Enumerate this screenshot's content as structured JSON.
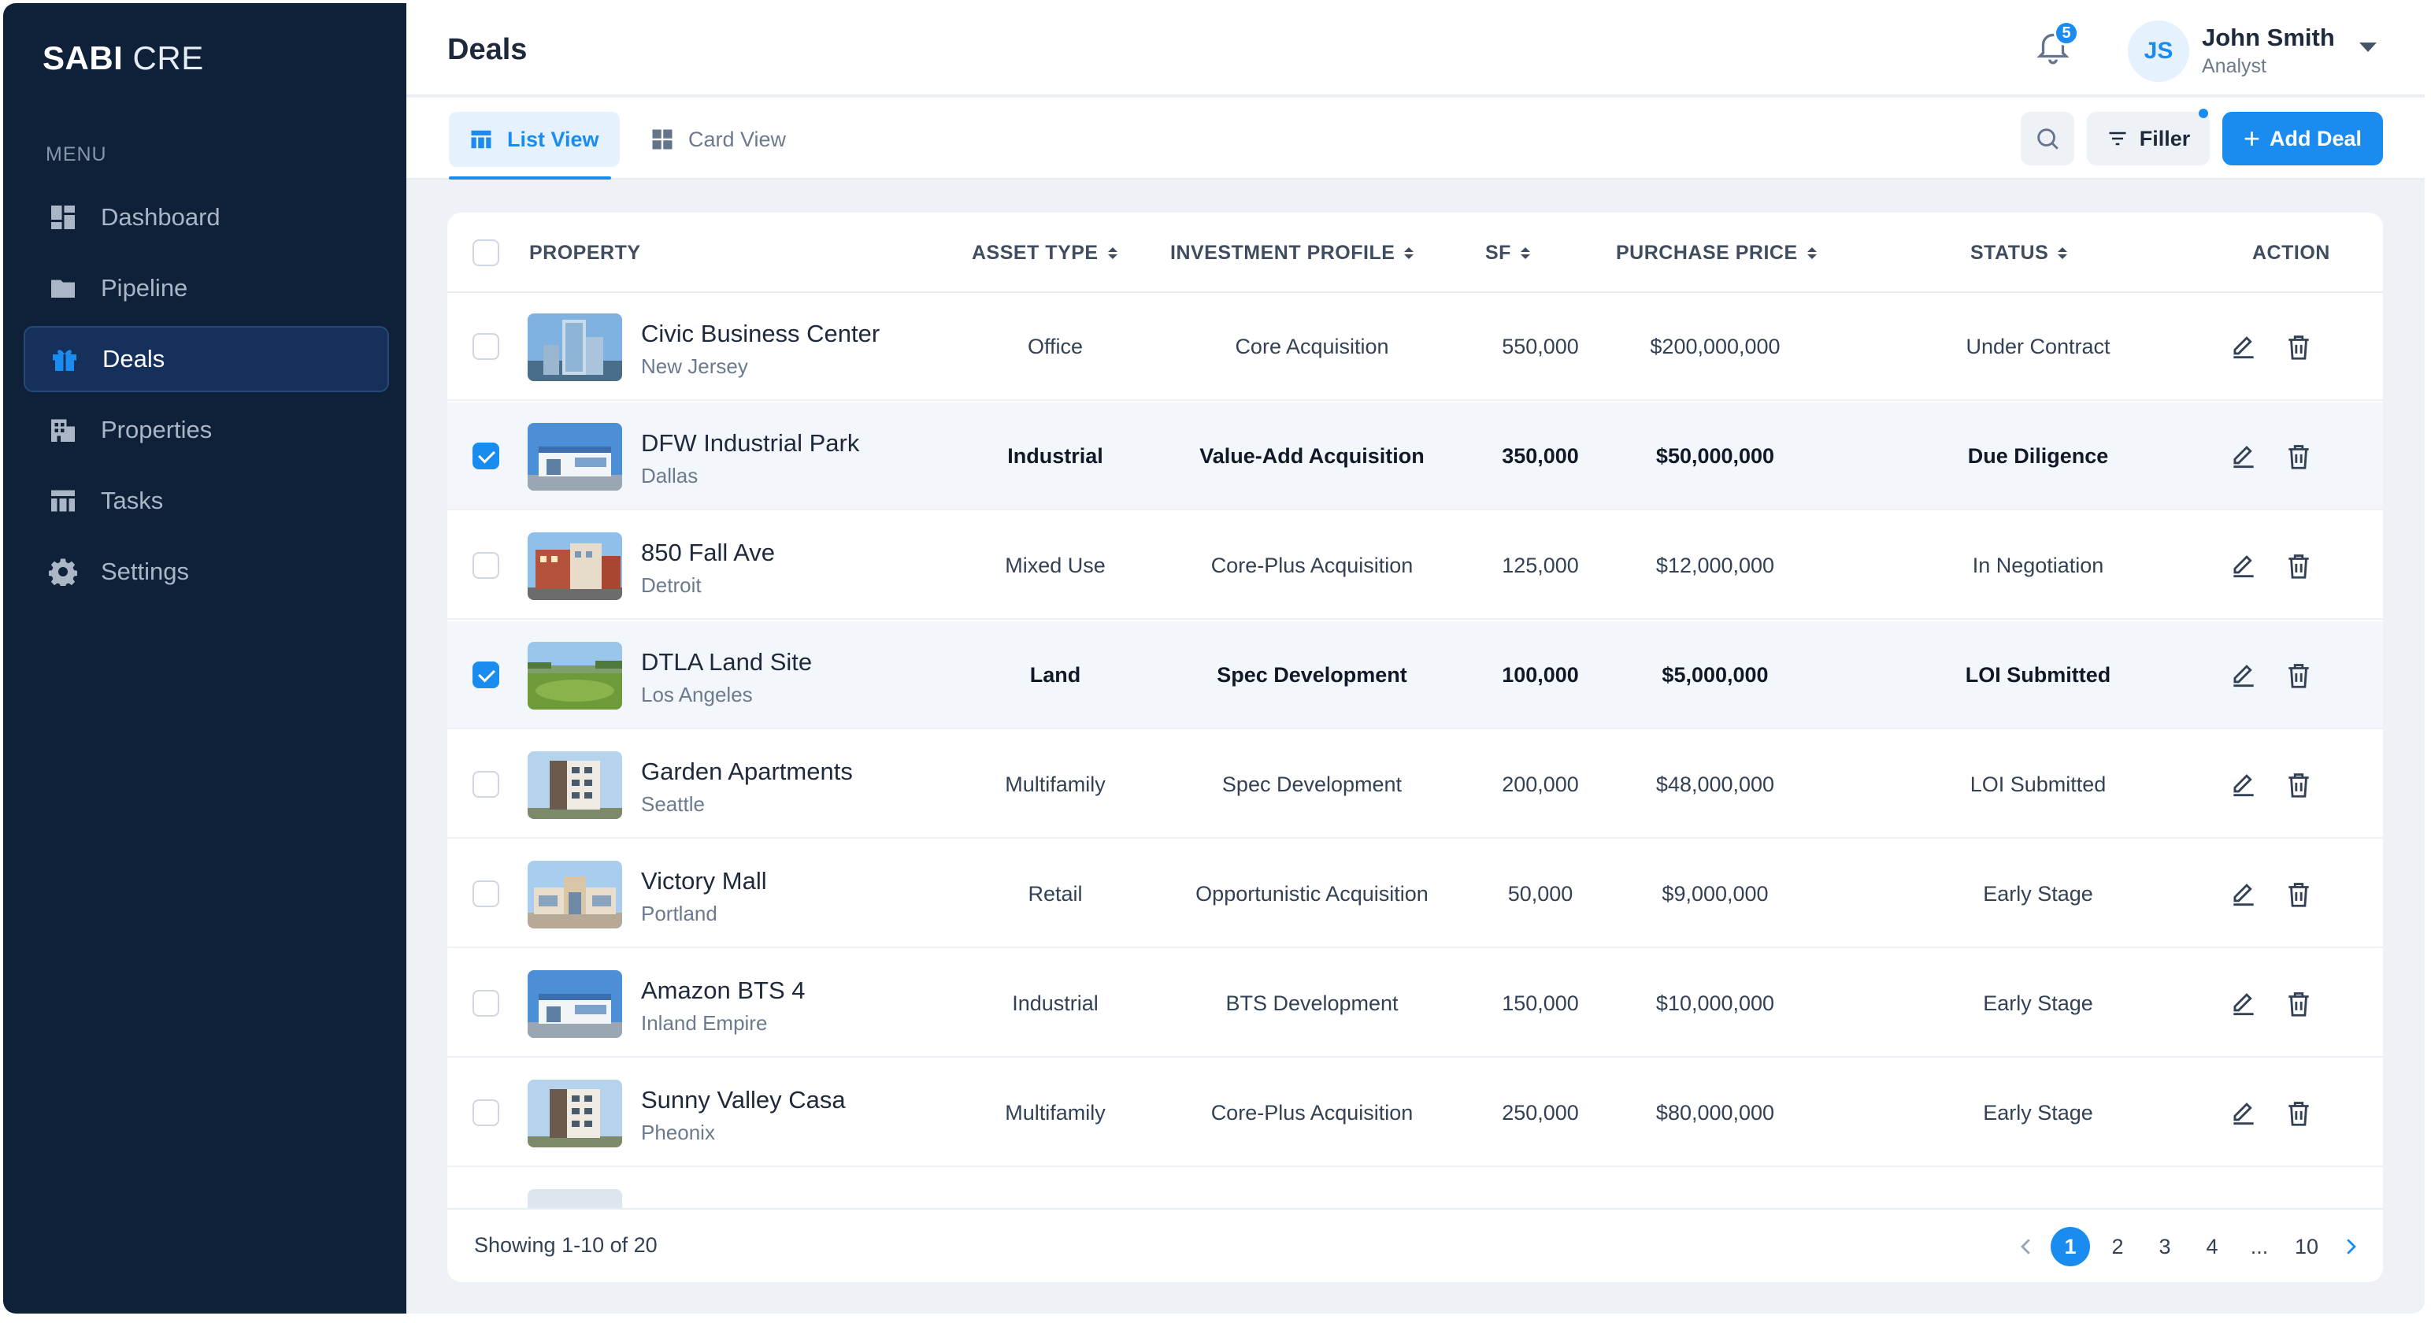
{
  "brand": {
    "bold": "SABI",
    "light": "CRE"
  },
  "sidebar": {
    "menu_title": "MENU",
    "items": [
      {
        "label": "Dashboard",
        "icon": "dashboard-icon",
        "active": false
      },
      {
        "label": "Pipeline",
        "icon": "folder-icon",
        "active": false
      },
      {
        "label": "Deals",
        "icon": "gift-icon",
        "active": true
      },
      {
        "label": "Properties",
        "icon": "building-icon",
        "active": false
      },
      {
        "label": "Tasks",
        "icon": "table-icon",
        "active": false
      },
      {
        "label": "Settings",
        "icon": "gear-icon",
        "active": false
      }
    ]
  },
  "header": {
    "title": "Deals",
    "notifications": "5",
    "user": {
      "initials": "JS",
      "name": "John Smith",
      "role": "Analyst"
    }
  },
  "toolbar": {
    "list_view": "List View",
    "card_view": "Card View",
    "filter_label": "Filler",
    "add_label": "Add Deal"
  },
  "table": {
    "columns": {
      "property": "PROPERTY",
      "asset_type": "ASSET TYPE",
      "investment_profile": "INVESTMENT PROFILE",
      "sf": "SF",
      "purchase_price": "PURCHASE PRICE",
      "status": "STATUS",
      "action": "ACTION"
    },
    "rows": [
      {
        "name": "Civic Business Center",
        "city": "New Jersey",
        "asset_type": "Office",
        "profile": "Core Acquisition",
        "sf": "550,000",
        "price": "$200,000,000",
        "status": "Under Contract",
        "checked": false,
        "thumb": "tower"
      },
      {
        "name": "DFW Industrial Park",
        "city": "Dallas",
        "asset_type": "Industrial",
        "profile": "Value-Add Acquisition",
        "sf": "350,000",
        "price": "$50,000,000",
        "status": "Due Diligence",
        "checked": true,
        "thumb": "industrial"
      },
      {
        "name": "850 Fall Ave",
        "city": "Detroit",
        "asset_type": "Mixed Use",
        "profile": "Core-Plus Acquisition",
        "sf": "125,000",
        "price": "$12,000,000",
        "status": "In Negotiation",
        "checked": false,
        "thumb": "mixed"
      },
      {
        "name": "DTLA Land Site",
        "city": "Los Angeles",
        "asset_type": "Land",
        "profile": "Spec Development",
        "sf": "100,000",
        "price": "$5,000,000",
        "status": "LOI Submitted",
        "checked": true,
        "thumb": "land"
      },
      {
        "name": "Garden Apartments",
        "city": "Seattle",
        "asset_type": "Multifamily",
        "profile": "Spec Development",
        "sf": "200,000",
        "price": "$48,000,000",
        "status": "LOI Submitted",
        "checked": false,
        "thumb": "apartment"
      },
      {
        "name": "Victory Mall",
        "city": "Portland",
        "asset_type": "Retail",
        "profile": "Opportunistic Acquisition",
        "sf": "50,000",
        "price": "$9,000,000",
        "status": "Early Stage",
        "checked": false,
        "thumb": "mall"
      },
      {
        "name": "Amazon BTS 4",
        "city": "Inland Empire",
        "asset_type": "Industrial",
        "profile": "BTS Development",
        "sf": "150,000",
        "price": "$10,000,000",
        "status": "Early Stage",
        "checked": false,
        "thumb": "industrial"
      },
      {
        "name": "Sunny Valley Casa",
        "city": "Pheonix",
        "asset_type": "Multifamily",
        "profile": "Core-Plus Acquisition",
        "sf": "250,000",
        "price": "$80,000,000",
        "status": "Early Stage",
        "checked": false,
        "thumb": "apartment"
      }
    ]
  },
  "pagination": {
    "showing": "Showing 1-10 of 20",
    "pages": [
      "1",
      "2",
      "3",
      "4",
      "...",
      "10"
    ],
    "current": "1"
  },
  "colors": {
    "accent": "#1a8cf0",
    "sidebar": "#0f2139",
    "background": "#eef2f7"
  }
}
